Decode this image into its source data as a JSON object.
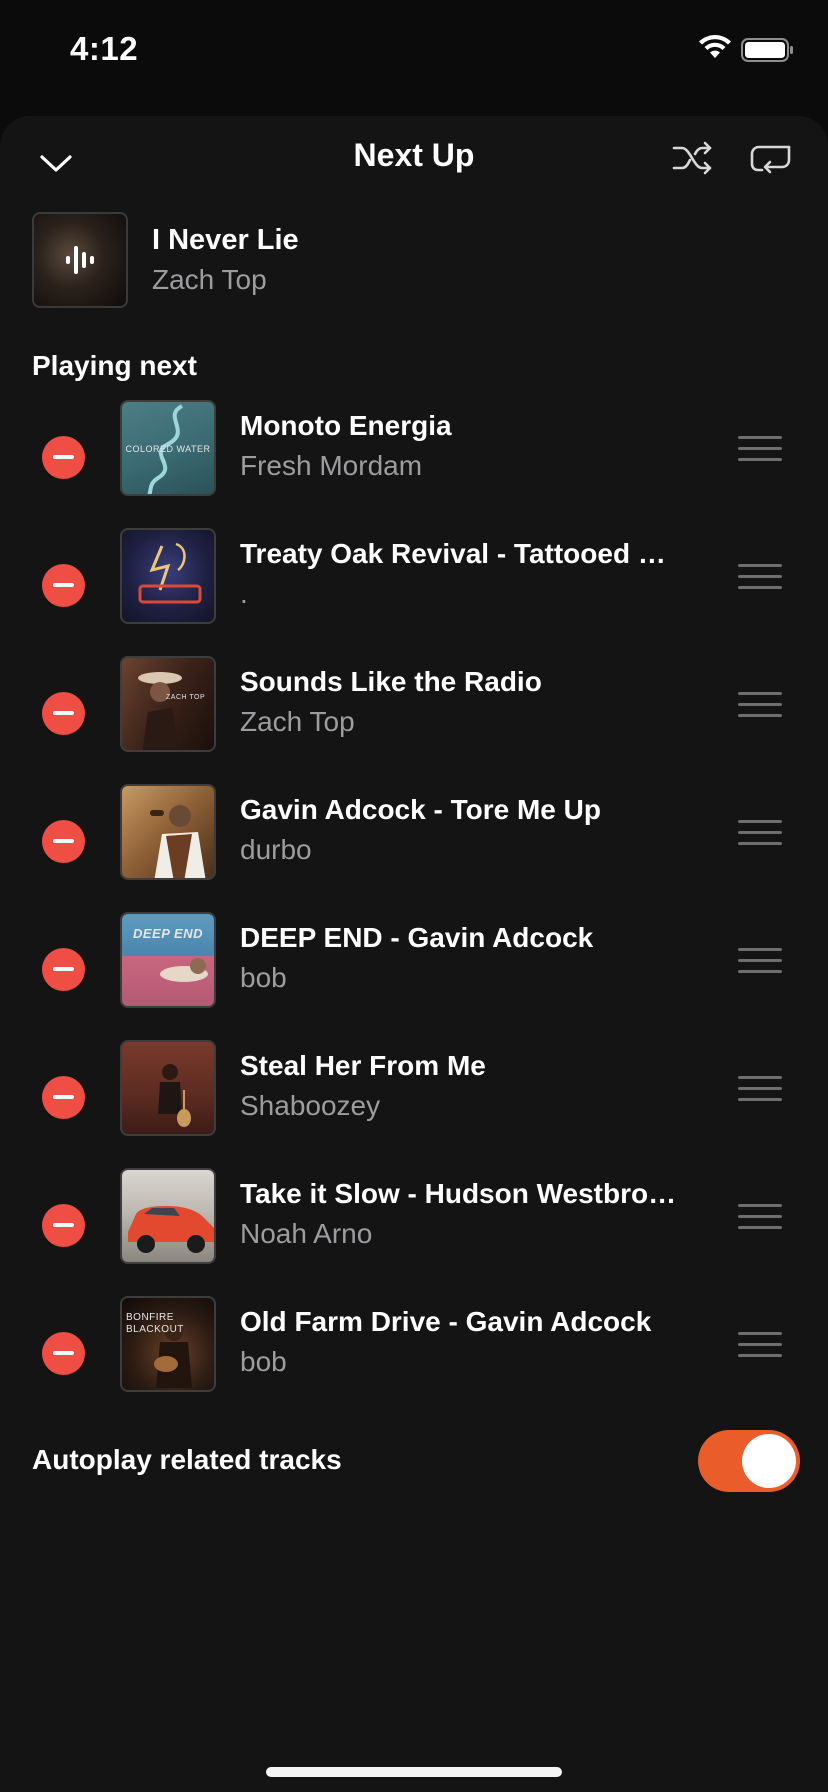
{
  "status_bar": {
    "time": "4:12"
  },
  "header": {
    "title": "Next Up"
  },
  "now_playing": {
    "title": "I Never Lie",
    "artist": "Zach Top"
  },
  "section_label": "Playing next",
  "queue": [
    {
      "title": "Monoto Energia",
      "artist": "Fresh Mordam",
      "art_text": "COLORED WATER"
    },
    {
      "title": "Treaty Oak Revival  -  Tattooed Heart",
      "artist": "."
    },
    {
      "title": "Sounds Like the Radio",
      "artist": "Zach Top",
      "art_text": "ZACH TOP"
    },
    {
      "title": "Gavin Adcock  -  Tore Me Up",
      "artist": "durbo"
    },
    {
      "title": "DEEP END  -  Gavin Adcock",
      "artist": "bob",
      "art_text": "DEEP END"
    },
    {
      "title": "Steal Her From Me",
      "artist": "Shaboozey"
    },
    {
      "title": "Take it Slow - Hudson Westbrook",
      "artist": "Noah Arno"
    },
    {
      "title": "Old Farm  Drive  -  Gavin Adcock",
      "artist": "bob",
      "art_text": "BONFIRE BLACKOUT"
    }
  ],
  "autoplay": {
    "label": "Autoplay related tracks",
    "enabled": true
  },
  "colors": {
    "accent": "#ea5c2a",
    "remove": "#ee4e43",
    "background": "#141415"
  }
}
